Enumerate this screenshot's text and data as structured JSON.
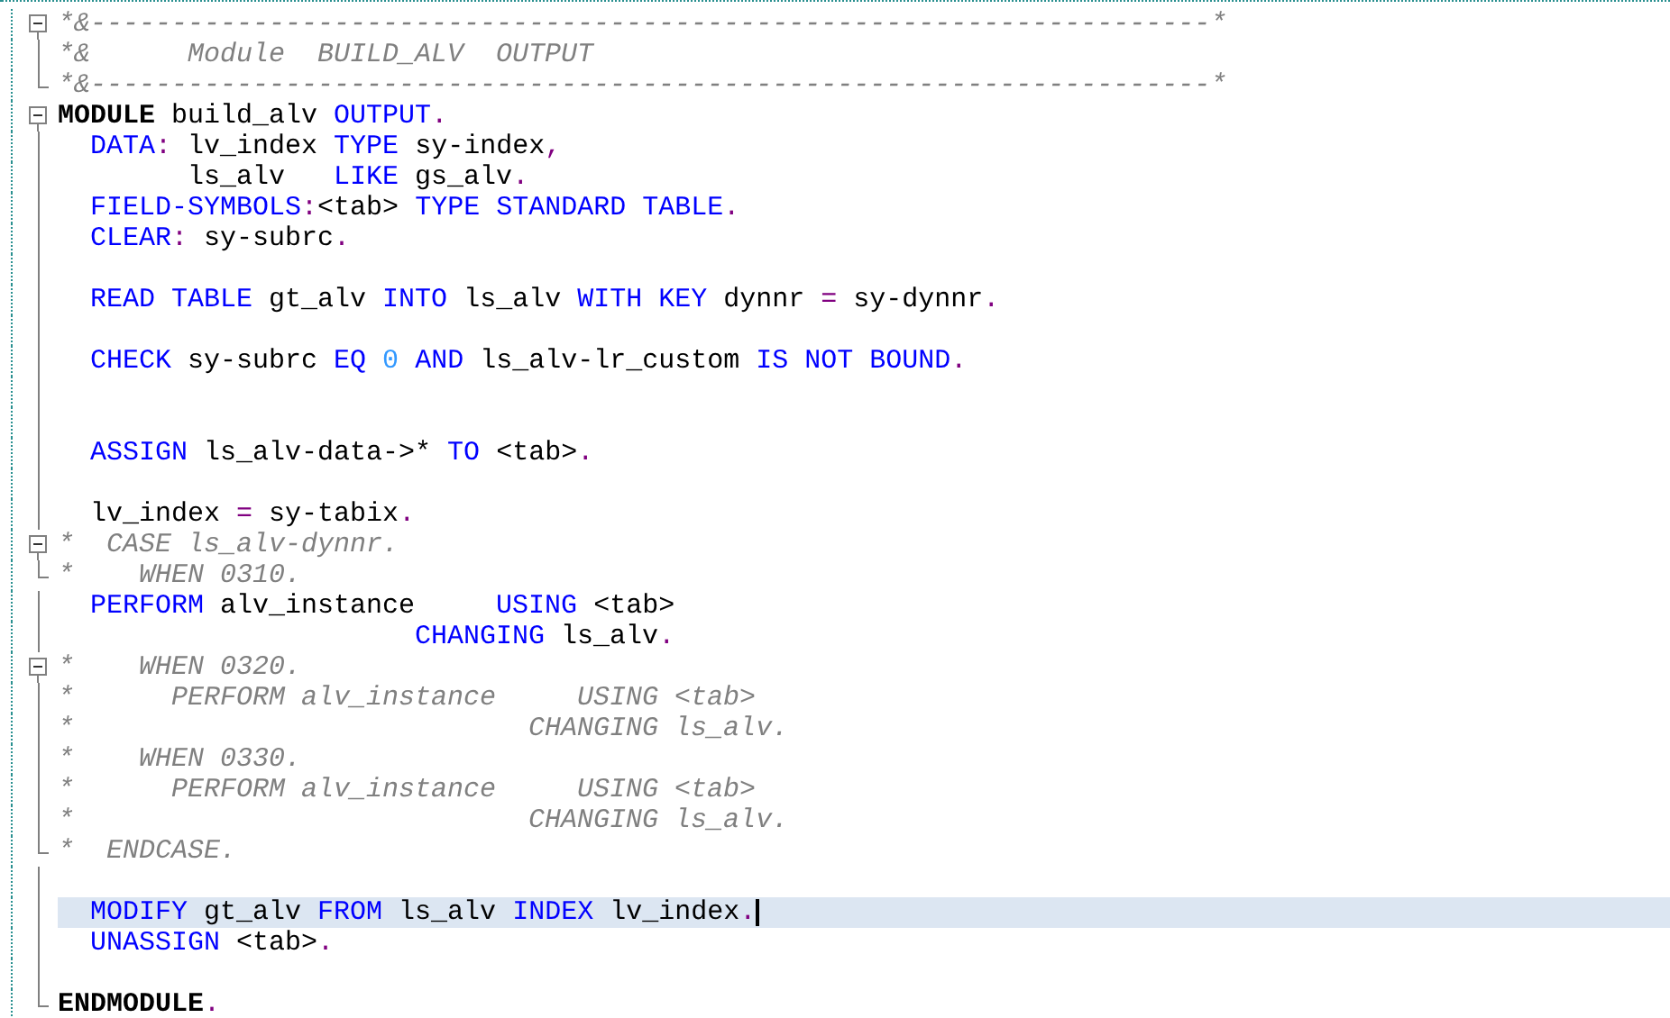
{
  "editor": {
    "lines": [
      {
        "kind": "fold-start",
        "current": false,
        "tokens": [
          {
            "kind": "comment",
            "text": "*&---------------------------------------------------------------------*"
          }
        ]
      },
      {
        "kind": "fold-continue",
        "current": false,
        "tokens": [
          {
            "kind": "comment",
            "text": "*&      Module  BUILD_ALV  OUTPUT"
          }
        ]
      },
      {
        "kind": "fold-end",
        "current": false,
        "tokens": [
          {
            "kind": "comment",
            "text": "*&---------------------------------------------------------------------*"
          }
        ]
      },
      {
        "kind": "fold-start",
        "current": false,
        "tokens": [
          {
            "kind": "strong",
            "text": "MODULE"
          },
          {
            "kind": "ident",
            "text": " build_alv "
          },
          {
            "kind": "keyword",
            "text": "OUTPUT"
          },
          {
            "kind": "op",
            "text": "."
          }
        ]
      },
      {
        "kind": "fold-continue",
        "current": false,
        "tokens": [
          {
            "kind": "keyword",
            "text": "  DATA"
          },
          {
            "kind": "op",
            "text": ":"
          },
          {
            "kind": "ident",
            "text": " lv_index "
          },
          {
            "kind": "keyword",
            "text": "TYPE"
          },
          {
            "kind": "ident",
            "text": " sy-index"
          },
          {
            "kind": "op",
            "text": ","
          }
        ]
      },
      {
        "kind": "fold-continue",
        "current": false,
        "tokens": [
          {
            "kind": "ident",
            "text": "        ls_alv   "
          },
          {
            "kind": "keyword",
            "text": "LIKE"
          },
          {
            "kind": "ident",
            "text": " gs_alv"
          },
          {
            "kind": "op",
            "text": "."
          }
        ]
      },
      {
        "kind": "fold-continue",
        "current": false,
        "tokens": [
          {
            "kind": "keyword",
            "text": "  FIELD-SYMBOLS"
          },
          {
            "kind": "op",
            "text": ":"
          },
          {
            "kind": "ident",
            "text": "<tab> "
          },
          {
            "kind": "keyword",
            "text": "TYPE STANDARD TABLE"
          },
          {
            "kind": "op",
            "text": "."
          }
        ]
      },
      {
        "kind": "fold-continue",
        "current": false,
        "tokens": [
          {
            "kind": "keyword",
            "text": "  CLEAR"
          },
          {
            "kind": "op",
            "text": ":"
          },
          {
            "kind": "ident",
            "text": " sy-subrc"
          },
          {
            "kind": "op",
            "text": "."
          }
        ]
      },
      {
        "kind": "fold-continue",
        "current": false
      },
      {
        "kind": "fold-continue",
        "current": false,
        "tokens": [
          {
            "kind": "keyword",
            "text": "  READ TABLE"
          },
          {
            "kind": "ident",
            "text": " gt_alv "
          },
          {
            "kind": "keyword",
            "text": "INTO"
          },
          {
            "kind": "ident",
            "text": " ls_alv "
          },
          {
            "kind": "keyword",
            "text": "WITH KEY"
          },
          {
            "kind": "ident",
            "text": " dynnr "
          },
          {
            "kind": "op",
            "text": "="
          },
          {
            "kind": "ident",
            "text": " sy-dynnr"
          },
          {
            "kind": "op",
            "text": "."
          }
        ]
      },
      {
        "kind": "fold-continue",
        "current": false
      },
      {
        "kind": "fold-continue",
        "current": false,
        "tokens": [
          {
            "kind": "keyword",
            "text": "  CHECK"
          },
          {
            "kind": "ident",
            "text": " sy-subrc "
          },
          {
            "kind": "keyword",
            "text": "EQ"
          },
          {
            "kind": "number",
            "text": " 0 "
          },
          {
            "kind": "keyword",
            "text": "AND"
          },
          {
            "kind": "ident",
            "text": " ls_alv-lr_custom "
          },
          {
            "kind": "keyword",
            "text": "IS NOT BOUND"
          },
          {
            "kind": "op",
            "text": "."
          }
        ]
      },
      {
        "kind": "fold-continue",
        "current": false
      },
      {
        "kind": "fold-continue",
        "current": false
      },
      {
        "kind": "fold-continue",
        "current": false,
        "tokens": [
          {
            "kind": "keyword",
            "text": "  ASSIGN"
          },
          {
            "kind": "ident",
            "text": " ls_alv-data->* "
          },
          {
            "kind": "keyword",
            "text": "TO"
          },
          {
            "kind": "ident",
            "text": " <tab>"
          },
          {
            "kind": "op",
            "text": "."
          }
        ]
      },
      {
        "kind": "fold-continue",
        "current": false
      },
      {
        "kind": "fold-continue",
        "current": false,
        "tokens": [
          {
            "kind": "ident",
            "text": "  lv_index "
          },
          {
            "kind": "op",
            "text": "="
          },
          {
            "kind": "ident",
            "text": " sy-tabix"
          },
          {
            "kind": "op",
            "text": "."
          }
        ]
      },
      {
        "kind": "fold-start",
        "current": false,
        "tokens": [
          {
            "kind": "comment",
            "text": "*  CASE ls_alv-dynnr."
          }
        ]
      },
      {
        "kind": "fold-end",
        "current": false,
        "tokens": [
          {
            "kind": "comment",
            "text": "*    WHEN 0310."
          }
        ]
      },
      {
        "kind": "fold-continue",
        "current": false,
        "tokens": [
          {
            "kind": "keyword",
            "text": "  PERFORM"
          },
          {
            "kind": "ident",
            "text": " alv_instance     "
          },
          {
            "kind": "keyword",
            "text": "USING"
          },
          {
            "kind": "ident",
            "text": " <tab>"
          }
        ]
      },
      {
        "kind": "fold-continue",
        "current": false,
        "tokens": [
          {
            "kind": "keyword",
            "text": "                      CHANGING"
          },
          {
            "kind": "ident",
            "text": " ls_alv"
          },
          {
            "kind": "op",
            "text": "."
          }
        ]
      },
      {
        "kind": "fold-start",
        "current": false,
        "tokens": [
          {
            "kind": "comment",
            "text": "*    WHEN 0320."
          }
        ]
      },
      {
        "kind": "fold-continue",
        "current": false,
        "tokens": [
          {
            "kind": "comment",
            "text": "*      PERFORM alv_instance     USING <tab>"
          }
        ]
      },
      {
        "kind": "fold-continue",
        "current": false,
        "tokens": [
          {
            "kind": "comment",
            "text": "*                            CHANGING ls_alv."
          }
        ]
      },
      {
        "kind": "fold-continue",
        "current": false,
        "tokens": [
          {
            "kind": "comment",
            "text": "*    WHEN 0330."
          }
        ]
      },
      {
        "kind": "fold-continue",
        "current": false,
        "tokens": [
          {
            "kind": "comment",
            "text": "*      PERFORM alv_instance     USING <tab>"
          }
        ]
      },
      {
        "kind": "fold-continue",
        "current": false,
        "tokens": [
          {
            "kind": "comment",
            "text": "*                            CHANGING ls_alv."
          }
        ]
      },
      {
        "kind": "fold-end",
        "current": false,
        "tokens": [
          {
            "kind": "comment",
            "text": "*  ENDCASE."
          }
        ]
      },
      {
        "kind": "fold-continue",
        "current": false
      },
      {
        "kind": "fold-continue",
        "current": true,
        "tokens": [
          {
            "kind": "keyword",
            "text": "  MODIFY"
          },
          {
            "kind": "ident",
            "text": " gt_alv "
          },
          {
            "kind": "keyword",
            "text": "FROM"
          },
          {
            "kind": "ident",
            "text": " ls_alv "
          },
          {
            "kind": "keyword",
            "text": "INDEX"
          },
          {
            "kind": "ident",
            "text": " lv_index"
          },
          {
            "kind": "op",
            "text": "."
          }
        ]
      },
      {
        "kind": "fold-continue",
        "current": false,
        "tokens": [
          {
            "kind": "keyword",
            "text": "  UNASSIGN"
          },
          {
            "kind": "ident",
            "text": " <tab>"
          },
          {
            "kind": "op",
            "text": "."
          }
        ]
      },
      {
        "kind": "fold-continue",
        "current": false
      },
      {
        "kind": "fold-end",
        "current": false,
        "tokens": [
          {
            "kind": "strong",
            "text": "ENDMODULE"
          },
          {
            "kind": "op",
            "text": "."
          }
        ]
      }
    ]
  }
}
